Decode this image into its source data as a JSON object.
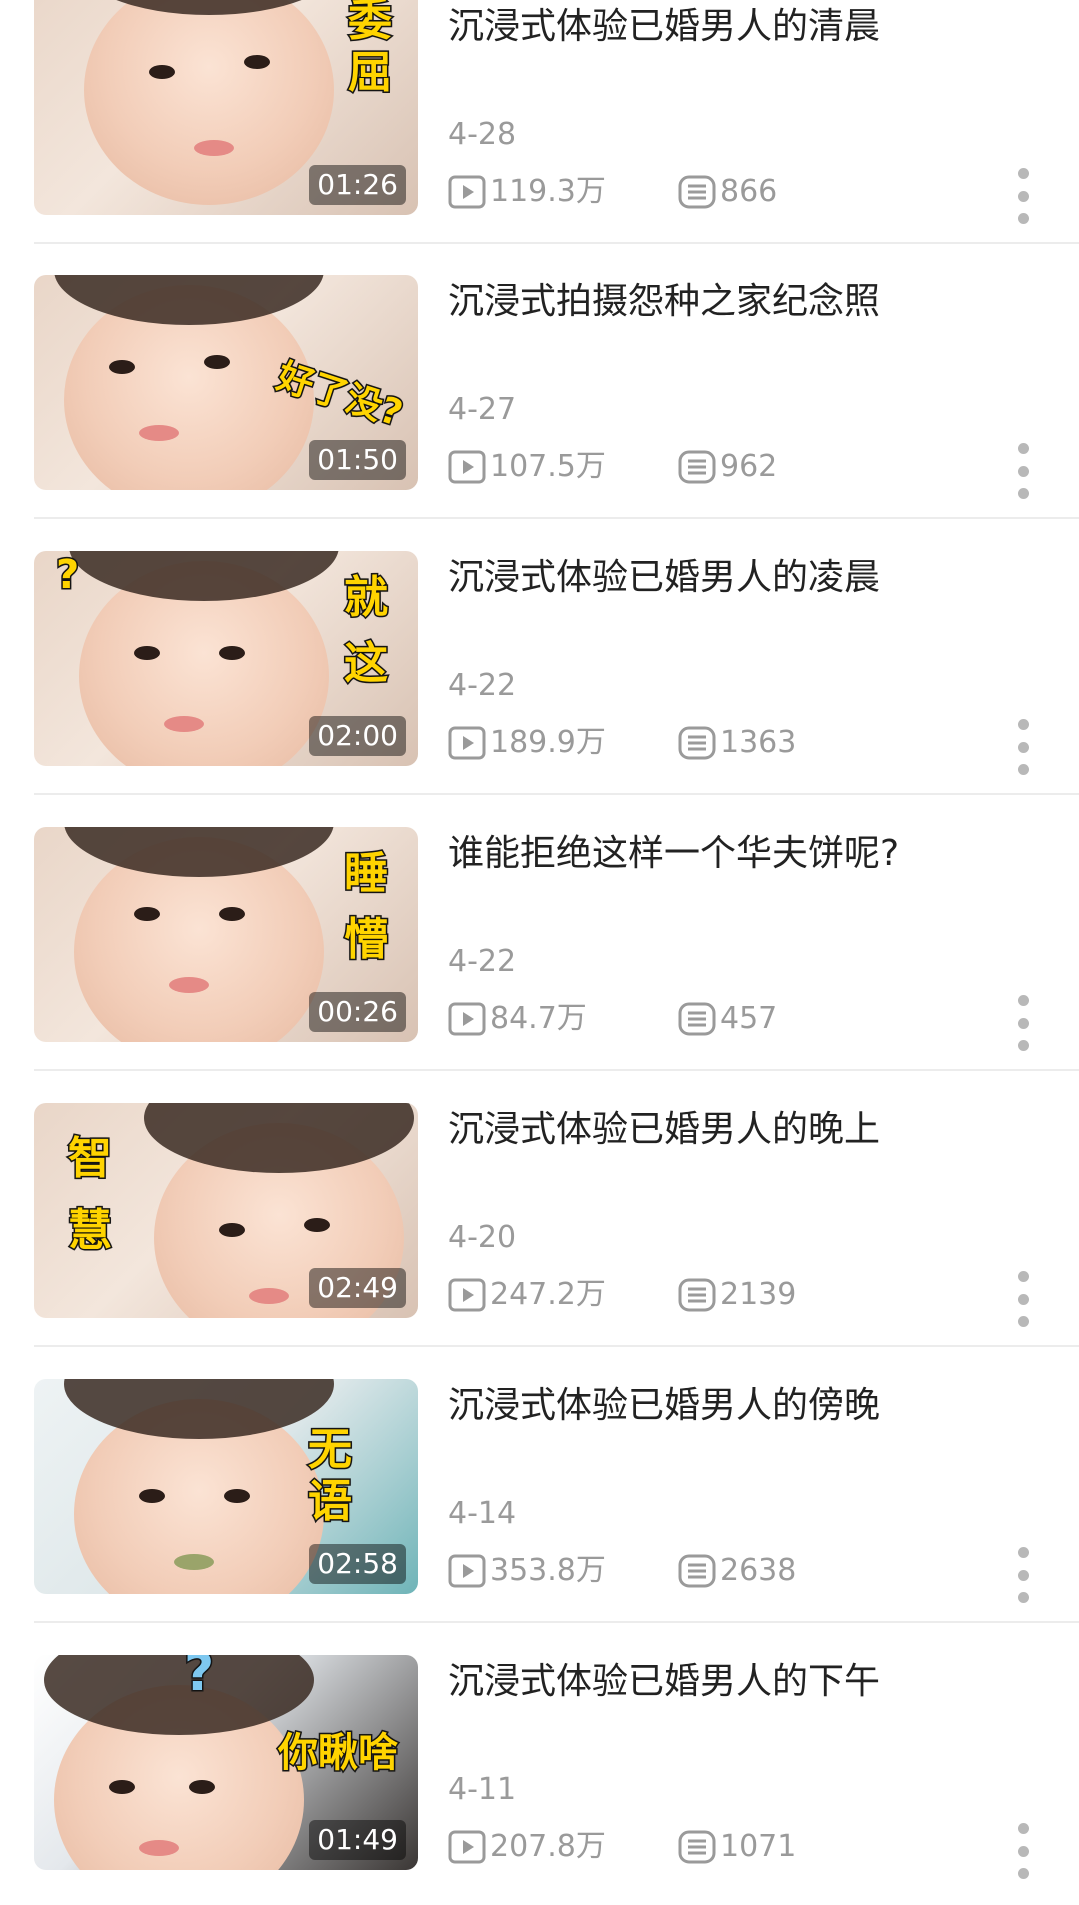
{
  "videos": [
    {
      "title": "沉浸式体验已婚男人的清晨",
      "date": "4-28",
      "views": "119.3万",
      "comments": "866",
      "duration": "01:26",
      "sticker": "委\n屈"
    },
    {
      "title": "沉浸式拍摄怨种之家纪念照",
      "date": "4-27",
      "views": "107.5万",
      "comments": "962",
      "duration": "01:50",
      "sticker": "好了没?"
    },
    {
      "title": "沉浸式体验已婚男人的凌晨",
      "date": "4-22",
      "views": "189.9万",
      "comments": "1363",
      "duration": "02:00",
      "sticker": "就\n这",
      "sticker2": "?"
    },
    {
      "title": "谁能拒绝这样一个华夫饼呢?",
      "date": "4-22",
      "views": "84.7万",
      "comments": "457",
      "duration": "00:26",
      "sticker": "睡\n懵"
    },
    {
      "title": "沉浸式体验已婚男人的晚上",
      "date": "4-20",
      "views": "247.2万",
      "comments": "2139",
      "duration": "02:49",
      "sticker": "智\n慧"
    },
    {
      "title": "沉浸式体验已婚男人的傍晚",
      "date": "4-14",
      "views": "353.8万",
      "comments": "2638",
      "duration": "02:58",
      "sticker": "无\n语"
    },
    {
      "title": "沉浸式体验已婚男人的下午",
      "date": "4-11",
      "views": "207.8万",
      "comments": "1071",
      "duration": "01:49",
      "sticker": "你瞅啥",
      "sticker2": "?"
    }
  ],
  "icons": {
    "views": "play-icon",
    "comments": "comment-icon",
    "more": "more-vertical-icon"
  },
  "colors": {
    "meta_text": "#9a9a9a",
    "title_text": "#222222",
    "sticker": "#ffd400",
    "divider": "#ececec"
  }
}
